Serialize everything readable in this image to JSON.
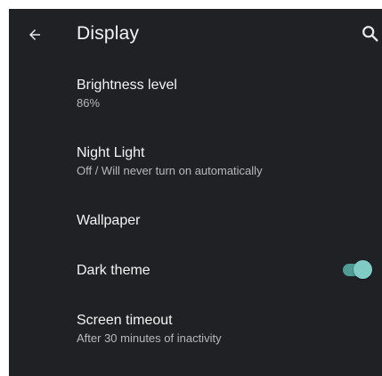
{
  "header": {
    "back_icon": "arrow-back-icon",
    "title": "Display",
    "search_icon": "search-icon"
  },
  "settings": [
    {
      "title": "Brightness level",
      "summary": "86%"
    },
    {
      "title": "Night Light",
      "summary": "Off / Will never turn on automatically"
    },
    {
      "title": "Wallpaper"
    },
    {
      "title": "Dark theme",
      "toggle_on": true
    },
    {
      "title": "Screen timeout",
      "summary": "After 30 minutes of inactivity"
    }
  ],
  "colors": {
    "background": "#202124",
    "accent": "#80cbc4",
    "text_primary": "#f1f3f4",
    "text_secondary": "#b5b8bd"
  }
}
